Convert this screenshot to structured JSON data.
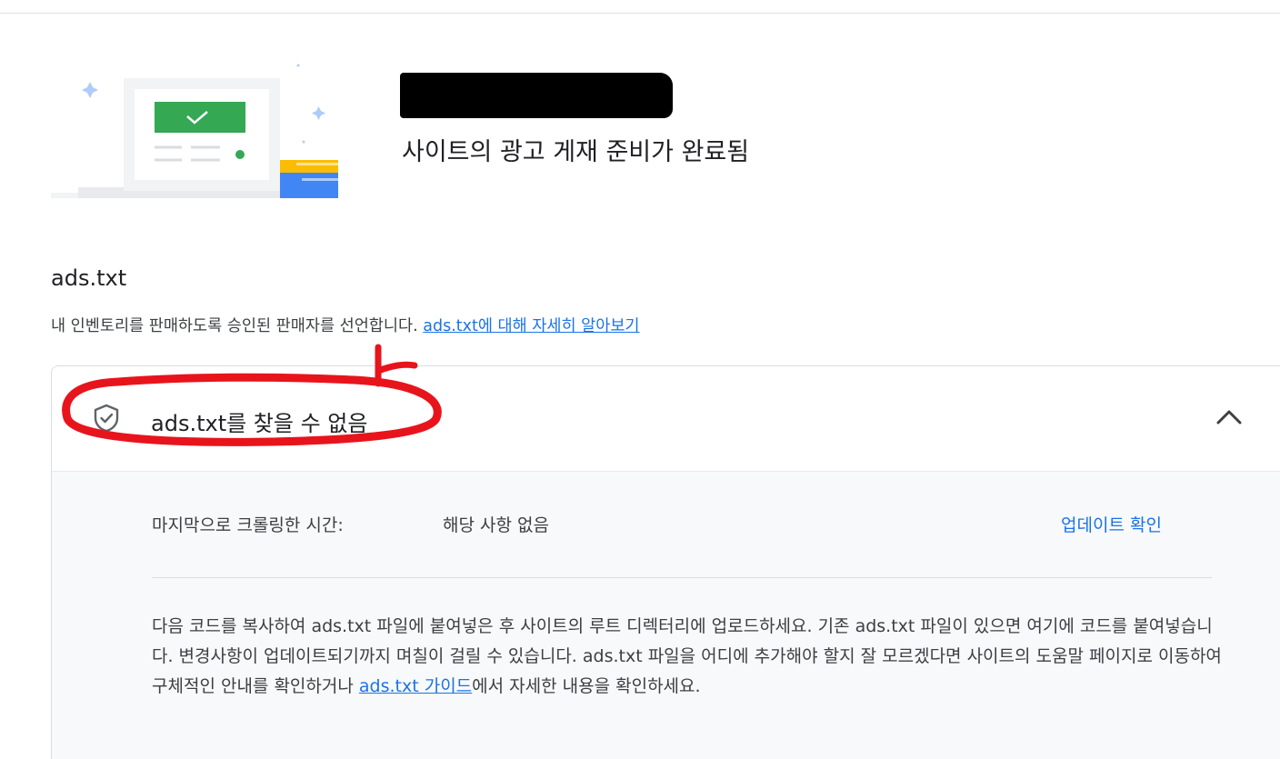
{
  "header": {
    "subtitle": "사이트의 광고 게재 준비가 완료됨"
  },
  "ads_txt": {
    "title": "ads.txt",
    "description": "내 인벤토리를 판매하도록 승인된 판매자를 선언합니다. ",
    "learn_more_link": "ads.txt에 대해 자세히 알아보기"
  },
  "status_card": {
    "status_label": "ads.txt를 찾을 수 없음",
    "crawl_label": "마지막으로 크롤링한 시간:",
    "crawl_value": "해당 사항 없음",
    "update_link": "업데이트 확인",
    "instructions_text": "다음 코드를 복사하여 ads.txt 파일에 붙여넣은 후 사이트의 루트 디렉터리에 업로드하세요. 기존 ads.txt 파일이 있으면 여기에 코드를 붙여넣습니다. 변경사항이 업데이트되기까지 며칠이 걸릴 수 있습니다. ads.txt 파일을 어디에 추가해야 할지 잘 모르겠다면 사이트의 도움말 페이지로 이동하여 구체적인 안내를 확인하거나 ",
    "guide_link": "ads.txt 가이드",
    "instructions_suffix": "에서 자세한 내용을 확인하세요."
  },
  "colors": {
    "link": "#1a73e8",
    "success_green": "#34a853",
    "annotation_red": "#e8141c"
  },
  "icons": [
    "checkmark-icon",
    "shield-check-icon",
    "chevron-up-icon"
  ]
}
